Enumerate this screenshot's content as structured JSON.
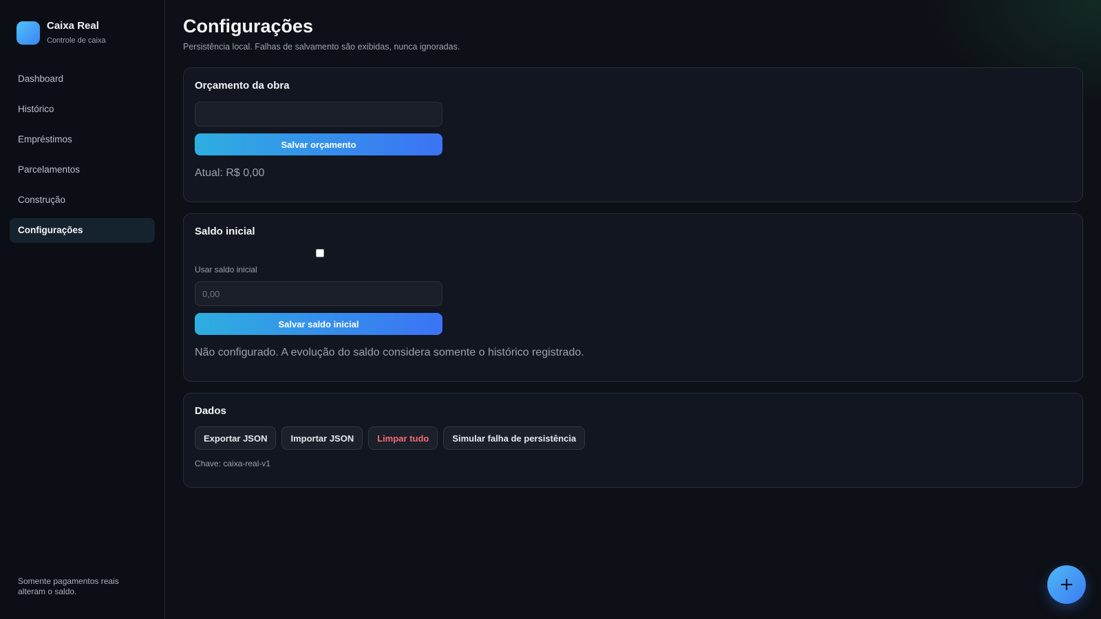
{
  "colors": {
    "background": "#0d1016",
    "sidebar": "#0b0e14",
    "card": "#121620",
    "accent_start": "#2eaee0",
    "accent_end": "#3b73f5",
    "danger": "#f26d78"
  },
  "brand": {
    "icon": "app-logo-icon",
    "title": "Caixa Real",
    "subtitle": "Controle de caixa"
  },
  "sidebar": {
    "items": [
      {
        "label": "Dashboard",
        "active": false
      },
      {
        "label": "Histórico",
        "active": false
      },
      {
        "label": "Empréstimos",
        "active": false
      },
      {
        "label": "Parcelamentos",
        "active": false
      },
      {
        "label": "Construção",
        "active": false
      },
      {
        "label": "Configurações",
        "active": true
      }
    ],
    "footer": "Somente pagamentos reais alteram o saldo."
  },
  "page": {
    "title": "Configurações",
    "subtitle": "Persistência local. Falhas de salvamento são exibidas, nunca ignoradas."
  },
  "budget": {
    "title": "Orçamento da obra",
    "input_value": "",
    "input_placeholder": "",
    "save_label": "Salvar orçamento",
    "current": "Atual: R$ 0,00"
  },
  "saldo": {
    "title": "Saldo inicial",
    "checkbox_checked": false,
    "checkbox_label": "Usar saldo inicial",
    "input_value": "",
    "input_placeholder": "0,00",
    "save_label": "Salvar saldo inicial",
    "status": "Não configurado. A evolução do saldo considera somente o histórico registrado."
  },
  "dados": {
    "title": "Dados",
    "export_label": "Exportar JSON",
    "import_label": "Importar JSON",
    "clear_label": "Limpar tudo",
    "simulate_label": "Simular falha de persistência",
    "key": "Chave: caixa-real-v1"
  },
  "fab": {
    "icon": "plus-icon",
    "label": "+"
  }
}
